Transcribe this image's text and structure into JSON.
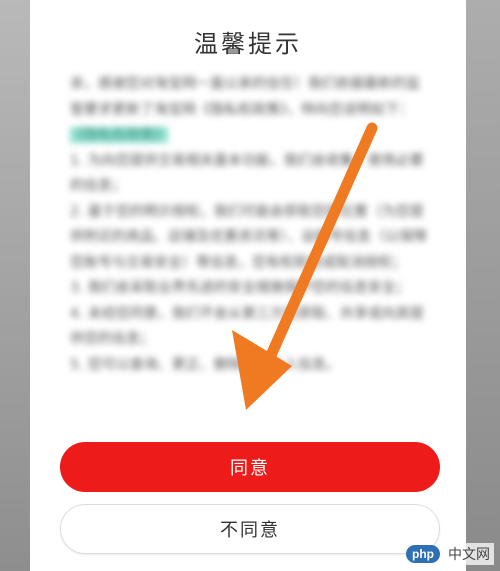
{
  "dialog": {
    "title": "温馨提示",
    "body_paragraphs": [
      "亲，感谢您对淘宝网一直以来的信任！我们依据最新的监管要求更新了淘宝网《隐私权政策》，特向您说明如下：",
      "1. 为向您提供交易相关基本功能，我们会收集、使用必要的信息；",
      "2. 基于您的明示授权，我们可能会获取您的位置（为您提供附近的商品、店铺及优惠资讯等）、设备号信息（以保障您账号与交易安全）等信息，您有权拒绝或取消授权；",
      "3. 我们会采取业界先进的安全措施保护您的信息安全；",
      "4. 未经您同意，我们不会从第三方处获取、共享或向其提供您的信息；",
      "5. 您可以查询、更正、删除您的个人信息。"
    ],
    "highlight_text": "《隐私权政策》",
    "agree_label": "同意",
    "disagree_label": "不同意"
  },
  "colors": {
    "agree_button": "#ee1b1b",
    "highlight": "#8fe0cf",
    "arrow": "#f07a21"
  },
  "icons": {
    "annotation_arrow": "arrow-pointing-to-agree-icon"
  },
  "watermark": {
    "badge": "php",
    "site": "中文网"
  }
}
